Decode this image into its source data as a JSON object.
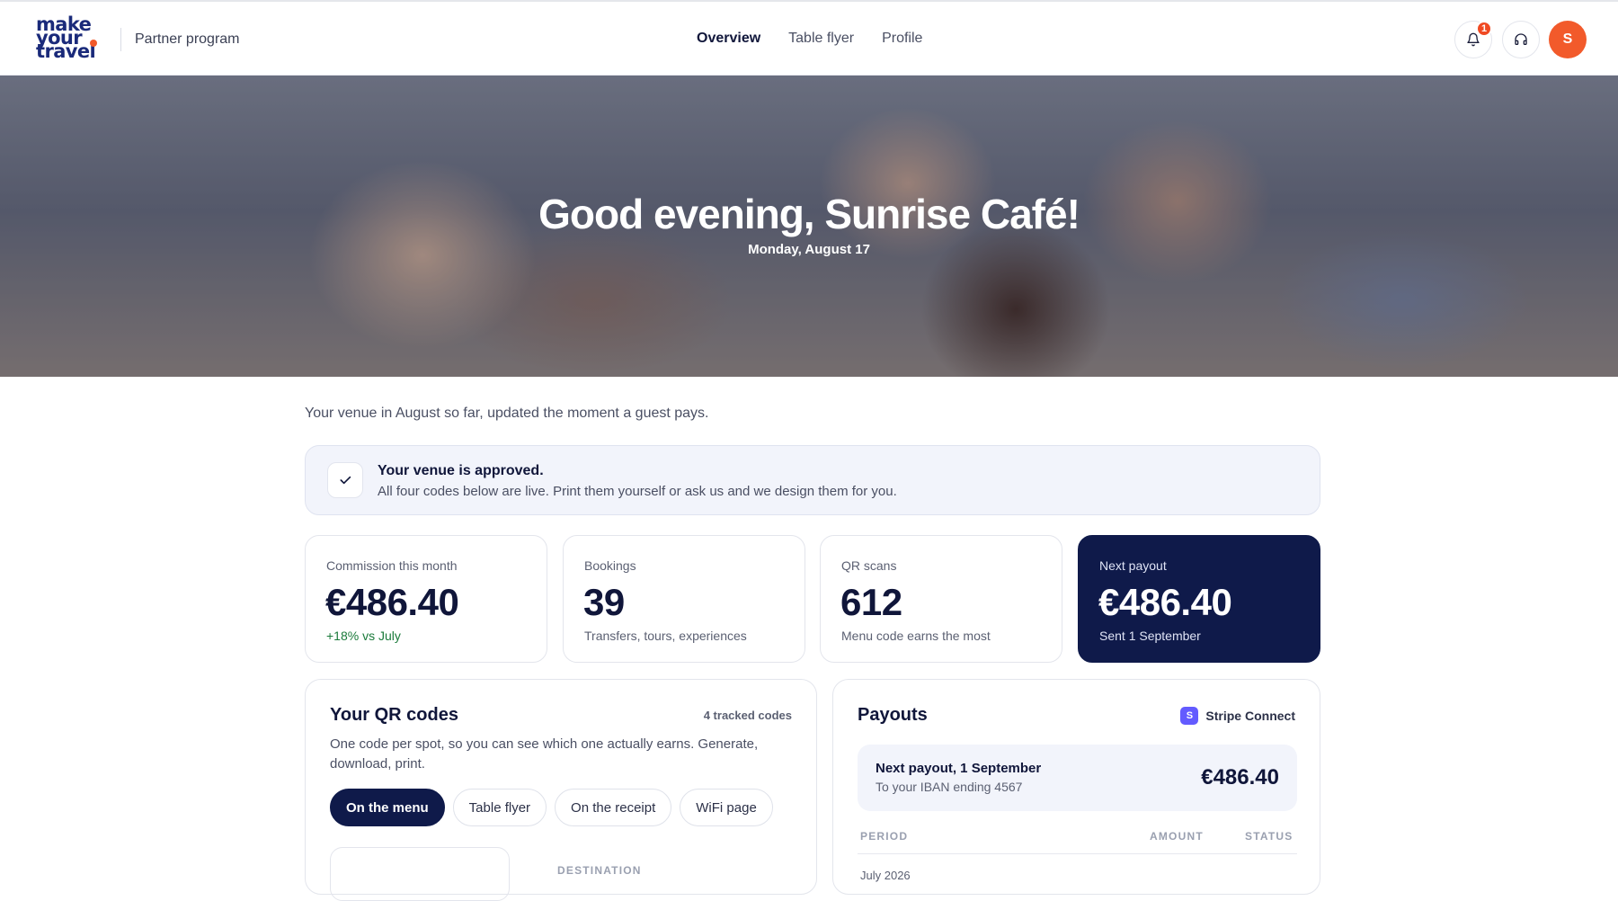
{
  "header": {
    "logo_lines": [
      "make",
      "your",
      "travel"
    ],
    "program_label": "Partner program",
    "nav": [
      {
        "label": "Overview",
        "active": true
      },
      {
        "label": "Table flyer",
        "active": false
      },
      {
        "label": "Profile",
        "active": false
      }
    ],
    "notification_count": "1",
    "avatar_initial": "S",
    "icons": [
      "bell-icon",
      "headset-icon"
    ]
  },
  "hero": {
    "title": "Good evening, Sunrise Café!",
    "date": "Monday, August 17"
  },
  "intro": "Your venue in August so far, updated the moment a guest pays.",
  "approval": {
    "title": "Your venue is approved.",
    "message": "All four codes below are live. Print them yourself or ask us and we design them for you."
  },
  "stats": [
    {
      "label": "Commission this month",
      "value": "€486.40",
      "sub": "+18% vs July"
    },
    {
      "label": "Bookings",
      "value": "39",
      "sub": "Transfers, tours, experiences"
    },
    {
      "label": "QR scans",
      "value": "612",
      "sub": "Menu code earns the most"
    },
    {
      "label": "Next payout",
      "value": "€486.40",
      "sub": "Sent 1 September"
    }
  ],
  "qr_codes": {
    "title": "Your QR codes",
    "count": "4 tracked codes",
    "description": "One code per spot, so you can see which one actually earns. Generate, download, print.",
    "tabs": [
      "On the menu",
      "Table flyer",
      "On the receipt",
      "WiFi page"
    ],
    "active_tab": "On the menu",
    "destination_label": "DESTINATION"
  },
  "payouts": {
    "title": "Payouts",
    "provider": "Stripe Connect",
    "provider_initial": "S",
    "next_title": "Next payout, 1 September",
    "next_sub": "To your IBAN ending 4567",
    "next_amount": "€486.40",
    "columns": [
      "PERIOD",
      "AMOUNT",
      "STATUS"
    ],
    "first_row_period": "July 2026"
  },
  "colors": {
    "brand_navy": "#0f1a4a",
    "accent_orange": "#f25a2b",
    "positive_green": "#1a7a3a",
    "stripe_purple": "#635bff"
  }
}
